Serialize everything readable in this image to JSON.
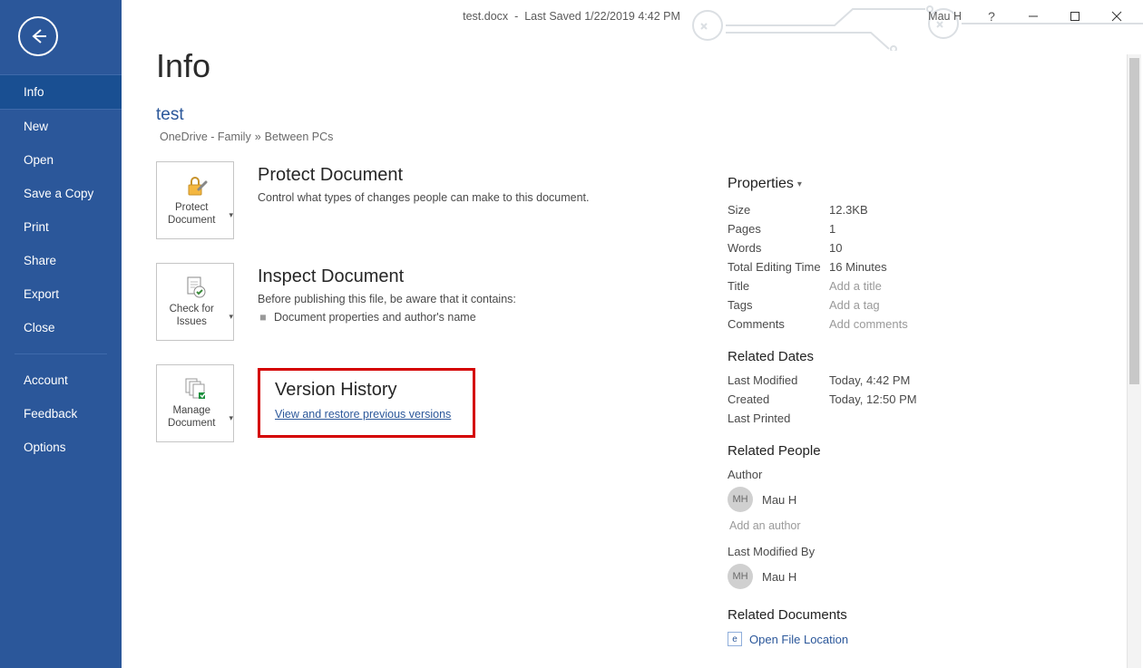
{
  "titlebar": {
    "filename": "test.docx",
    "last_saved": "Last Saved 1/22/2019 4:42 PM",
    "user": "Mau H"
  },
  "sidebar": {
    "items": [
      "Info",
      "New",
      "Open",
      "Save a Copy",
      "Print",
      "Share",
      "Export",
      "Close"
    ],
    "bottom": [
      "Account",
      "Feedback",
      "Options"
    ],
    "active_index": 0
  },
  "page": {
    "heading": "Info",
    "doc_name": "test",
    "breadcrumb": [
      "OneDrive - Family",
      "Between PCs"
    ]
  },
  "sections": {
    "protect": {
      "tile_label": "Protect Document",
      "title": "Protect Document",
      "desc": "Control what types of changes people can make to this document."
    },
    "inspect": {
      "tile_label": "Check for Issues",
      "title": "Inspect Document",
      "desc": "Before publishing this file, be aware that it contains:",
      "items": [
        "Document properties and author's name"
      ]
    },
    "version": {
      "tile_label": "Manage Document",
      "title": "Version History",
      "link": "View and restore previous versions"
    }
  },
  "properties": {
    "header": "Properties",
    "rows": [
      {
        "k": "Size",
        "v": "12.3KB"
      },
      {
        "k": "Pages",
        "v": "1"
      },
      {
        "k": "Words",
        "v": "10"
      },
      {
        "k": "Total Editing Time",
        "v": "16 Minutes"
      },
      {
        "k": "Title",
        "v": "Add a title",
        "ph": true
      },
      {
        "k": "Tags",
        "v": "Add a tag",
        "ph": true
      },
      {
        "k": "Comments",
        "v": "Add comments",
        "ph": true
      }
    ],
    "dates_header": "Related Dates",
    "dates": [
      {
        "k": "Last Modified",
        "v": "Today, 4:42 PM"
      },
      {
        "k": "Created",
        "v": "Today, 12:50 PM"
      },
      {
        "k": "Last Printed",
        "v": ""
      }
    ],
    "people_header": "Related People",
    "author_label": "Author",
    "author_name": "Mau H",
    "author_initials": "MH",
    "add_author": "Add an author",
    "modified_label": "Last Modified By",
    "modified_name": "Mau H",
    "modified_initials": "MH",
    "docs_header": "Related Documents",
    "open_location": "Open File Location"
  }
}
